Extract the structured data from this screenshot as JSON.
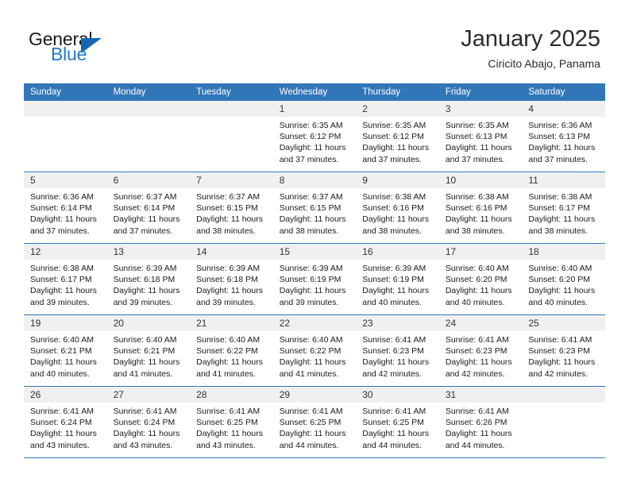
{
  "brand": {
    "name_top": "General",
    "name_bottom": "Blue",
    "accent_color": "#1667b0",
    "text_color": "#1a1a1a"
  },
  "header": {
    "title": "January 2025",
    "subtitle": "Ciricito Abajo, Panama",
    "header_bg": "#3176b8",
    "daynum_bg": "#f0f0f0"
  },
  "weekdays": [
    "Sunday",
    "Monday",
    "Tuesday",
    "Wednesday",
    "Thursday",
    "Friday",
    "Saturday"
  ],
  "labels": {
    "sunrise": "Sunrise:",
    "sunset": "Sunset:",
    "daylight": "Daylight:"
  },
  "weeks": [
    [
      {
        "day": "",
        "blank": true
      },
      {
        "day": "",
        "blank": true
      },
      {
        "day": "",
        "blank": true
      },
      {
        "day": "1",
        "sunrise": "Sunrise: 6:35 AM",
        "sunset": "Sunset: 6:12 PM",
        "daylight1": "Daylight: 11 hours",
        "daylight2": "and 37 minutes."
      },
      {
        "day": "2",
        "sunrise": "Sunrise: 6:35 AM",
        "sunset": "Sunset: 6:12 PM",
        "daylight1": "Daylight: 11 hours",
        "daylight2": "and 37 minutes."
      },
      {
        "day": "3",
        "sunrise": "Sunrise: 6:35 AM",
        "sunset": "Sunset: 6:13 PM",
        "daylight1": "Daylight: 11 hours",
        "daylight2": "and 37 minutes."
      },
      {
        "day": "4",
        "sunrise": "Sunrise: 6:36 AM",
        "sunset": "Sunset: 6:13 PM",
        "daylight1": "Daylight: 11 hours",
        "daylight2": "and 37 minutes."
      }
    ],
    [
      {
        "day": "5",
        "sunrise": "Sunrise: 6:36 AM",
        "sunset": "Sunset: 6:14 PM",
        "daylight1": "Daylight: 11 hours",
        "daylight2": "and 37 minutes."
      },
      {
        "day": "6",
        "sunrise": "Sunrise: 6:37 AM",
        "sunset": "Sunset: 6:14 PM",
        "daylight1": "Daylight: 11 hours",
        "daylight2": "and 37 minutes."
      },
      {
        "day": "7",
        "sunrise": "Sunrise: 6:37 AM",
        "sunset": "Sunset: 6:15 PM",
        "daylight1": "Daylight: 11 hours",
        "daylight2": "and 38 minutes."
      },
      {
        "day": "8",
        "sunrise": "Sunrise: 6:37 AM",
        "sunset": "Sunset: 6:15 PM",
        "daylight1": "Daylight: 11 hours",
        "daylight2": "and 38 minutes."
      },
      {
        "day": "9",
        "sunrise": "Sunrise: 6:38 AM",
        "sunset": "Sunset: 6:16 PM",
        "daylight1": "Daylight: 11 hours",
        "daylight2": "and 38 minutes."
      },
      {
        "day": "10",
        "sunrise": "Sunrise: 6:38 AM",
        "sunset": "Sunset: 6:16 PM",
        "daylight1": "Daylight: 11 hours",
        "daylight2": "and 38 minutes."
      },
      {
        "day": "11",
        "sunrise": "Sunrise: 6:38 AM",
        "sunset": "Sunset: 6:17 PM",
        "daylight1": "Daylight: 11 hours",
        "daylight2": "and 38 minutes."
      }
    ],
    [
      {
        "day": "12",
        "sunrise": "Sunrise: 6:38 AM",
        "sunset": "Sunset: 6:17 PM",
        "daylight1": "Daylight: 11 hours",
        "daylight2": "and 39 minutes."
      },
      {
        "day": "13",
        "sunrise": "Sunrise: 6:39 AM",
        "sunset": "Sunset: 6:18 PM",
        "daylight1": "Daylight: 11 hours",
        "daylight2": "and 39 minutes."
      },
      {
        "day": "14",
        "sunrise": "Sunrise: 6:39 AM",
        "sunset": "Sunset: 6:18 PM",
        "daylight1": "Daylight: 11 hours",
        "daylight2": "and 39 minutes."
      },
      {
        "day": "15",
        "sunrise": "Sunrise: 6:39 AM",
        "sunset": "Sunset: 6:19 PM",
        "daylight1": "Daylight: 11 hours",
        "daylight2": "and 39 minutes."
      },
      {
        "day": "16",
        "sunrise": "Sunrise: 6:39 AM",
        "sunset": "Sunset: 6:19 PM",
        "daylight1": "Daylight: 11 hours",
        "daylight2": "and 40 minutes."
      },
      {
        "day": "17",
        "sunrise": "Sunrise: 6:40 AM",
        "sunset": "Sunset: 6:20 PM",
        "daylight1": "Daylight: 11 hours",
        "daylight2": "and 40 minutes."
      },
      {
        "day": "18",
        "sunrise": "Sunrise: 6:40 AM",
        "sunset": "Sunset: 6:20 PM",
        "daylight1": "Daylight: 11 hours",
        "daylight2": "and 40 minutes."
      }
    ],
    [
      {
        "day": "19",
        "sunrise": "Sunrise: 6:40 AM",
        "sunset": "Sunset: 6:21 PM",
        "daylight1": "Daylight: 11 hours",
        "daylight2": "and 40 minutes."
      },
      {
        "day": "20",
        "sunrise": "Sunrise: 6:40 AM",
        "sunset": "Sunset: 6:21 PM",
        "daylight1": "Daylight: 11 hours",
        "daylight2": "and 41 minutes."
      },
      {
        "day": "21",
        "sunrise": "Sunrise: 6:40 AM",
        "sunset": "Sunset: 6:22 PM",
        "daylight1": "Daylight: 11 hours",
        "daylight2": "and 41 minutes."
      },
      {
        "day": "22",
        "sunrise": "Sunrise: 6:40 AM",
        "sunset": "Sunset: 6:22 PM",
        "daylight1": "Daylight: 11 hours",
        "daylight2": "and 41 minutes."
      },
      {
        "day": "23",
        "sunrise": "Sunrise: 6:41 AM",
        "sunset": "Sunset: 6:23 PM",
        "daylight1": "Daylight: 11 hours",
        "daylight2": "and 42 minutes."
      },
      {
        "day": "24",
        "sunrise": "Sunrise: 6:41 AM",
        "sunset": "Sunset: 6:23 PM",
        "daylight1": "Daylight: 11 hours",
        "daylight2": "and 42 minutes."
      },
      {
        "day": "25",
        "sunrise": "Sunrise: 6:41 AM",
        "sunset": "Sunset: 6:23 PM",
        "daylight1": "Daylight: 11 hours",
        "daylight2": "and 42 minutes."
      }
    ],
    [
      {
        "day": "26",
        "sunrise": "Sunrise: 6:41 AM",
        "sunset": "Sunset: 6:24 PM",
        "daylight1": "Daylight: 11 hours",
        "daylight2": "and 43 minutes."
      },
      {
        "day": "27",
        "sunrise": "Sunrise: 6:41 AM",
        "sunset": "Sunset: 6:24 PM",
        "daylight1": "Daylight: 11 hours",
        "daylight2": "and 43 minutes."
      },
      {
        "day": "28",
        "sunrise": "Sunrise: 6:41 AM",
        "sunset": "Sunset: 6:25 PM",
        "daylight1": "Daylight: 11 hours",
        "daylight2": "and 43 minutes."
      },
      {
        "day": "29",
        "sunrise": "Sunrise: 6:41 AM",
        "sunset": "Sunset: 6:25 PM",
        "daylight1": "Daylight: 11 hours",
        "daylight2": "and 44 minutes."
      },
      {
        "day": "30",
        "sunrise": "Sunrise: 6:41 AM",
        "sunset": "Sunset: 6:25 PM",
        "daylight1": "Daylight: 11 hours",
        "daylight2": "and 44 minutes."
      },
      {
        "day": "31",
        "sunrise": "Sunrise: 6:41 AM",
        "sunset": "Sunset: 6:26 PM",
        "daylight1": "Daylight: 11 hours",
        "daylight2": "and 44 minutes."
      },
      {
        "day": "",
        "blank": true
      }
    ]
  ]
}
